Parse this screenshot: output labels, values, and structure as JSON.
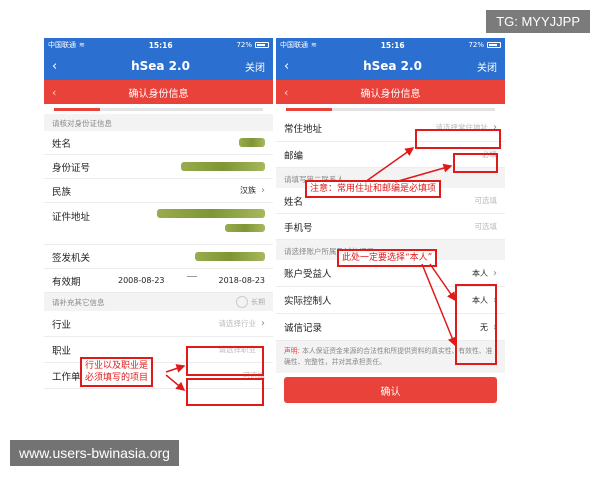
{
  "status_bar": {
    "left": {
      "carrier": "中国联通",
      "wifi_icon": "wifi-icon"
    },
    "right": {
      "time": "15:16",
      "battery": "72%"
    }
  },
  "nav": {
    "title": "hSea 2.0",
    "back_icon": "‹",
    "close_label": "关闭"
  },
  "sub_header": {
    "title": "确认身份信息",
    "back_icon": "‹"
  },
  "colors": {
    "nav_blue": "#2b6fd1",
    "accent_red": "#e8423b",
    "annotation_red": "#e01919",
    "blur_green": "#7f9a2e"
  },
  "left_screen": {
    "progress_percent": 22,
    "id_section_label": "请核对身份证信息",
    "fields": [
      {
        "label": "姓名"
      },
      {
        "label": "身份证号"
      },
      {
        "label": "民族",
        "value": "汉族"
      },
      {
        "label": "证件地址"
      },
      {
        "label": "签发机关"
      }
    ],
    "validity": {
      "label": "有效期",
      "start": "2008-08-23",
      "end": "2018-08-23",
      "long_term_label": "长期"
    },
    "other_section_label": "请补充其它信息",
    "industry": {
      "label": "行业",
      "placeholder": "请选择行业"
    },
    "occupation": {
      "label": "职业",
      "placeholder": "请选择职业"
    },
    "employer": {
      "label": "工作单位",
      "placeholder": "可选填"
    },
    "annotation": "行业以及职业是\n必须填写的项目"
  },
  "right_screen": {
    "progress_percent": 22,
    "address": {
      "label": "常住地址",
      "placeholder": "请选择常住地址"
    },
    "postcode": {
      "label": "邮编",
      "placeholder": "必填"
    },
    "contact_section_label": "请填写第二联系人",
    "contact_name": {
      "label": "姓名",
      "placeholder": "可选填"
    },
    "contact_phone": {
      "label": "手机号",
      "placeholder": "可选填"
    },
    "account_section_label": "请选择账户所属及诚信记录",
    "beneficiary": {
      "label": "账户受益人",
      "value": "本人"
    },
    "controller": {
      "label": "实际控制人",
      "value": "本人"
    },
    "credit": {
      "label": "诚信记录",
      "value": "无"
    },
    "declaration_label": "声明:",
    "declaration_text": "本人保证资金来源的合法性和所提供资料的真实性、有效性、准确性、完整性，并对其承担责任。",
    "confirm_label": "确认",
    "annotation_address": "注意：常用住址和邮编是必填项",
    "annotation_self": "此处一定要选择“本人”"
  },
  "watermarks": {
    "top_right": "TG: MYYJJPP",
    "bottom_left": "www.users-bwinasia.org"
  }
}
